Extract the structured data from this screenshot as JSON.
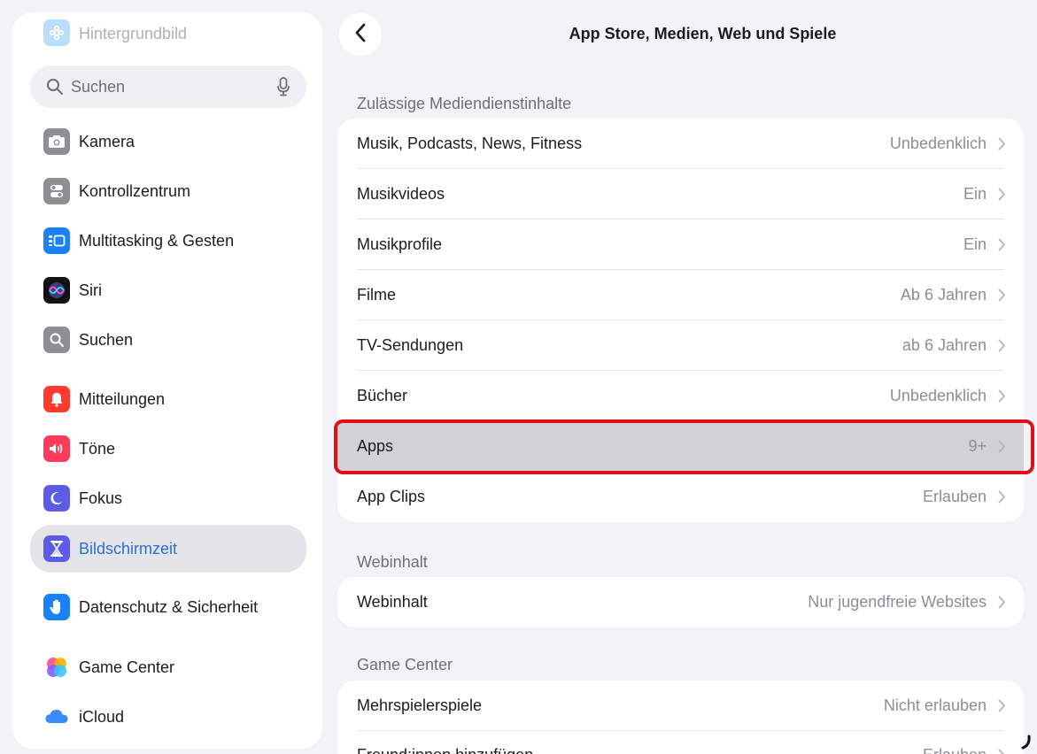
{
  "sidebar": {
    "top_item": "Hintergrundbild",
    "search_placeholder": "Suchen",
    "items": [
      {
        "label": "Kamera"
      },
      {
        "label": "Kontrollzentrum"
      },
      {
        "label": "Multitasking & Gesten"
      },
      {
        "label": "Siri"
      },
      {
        "label": "Suchen"
      },
      {
        "label": "Mitteilungen"
      },
      {
        "label": "Töne"
      },
      {
        "label": "Fokus"
      },
      {
        "label": "Bildschirmzeit",
        "selected": true
      },
      {
        "label": "Datenschutz & Sicherheit"
      },
      {
        "label": "Game Center"
      },
      {
        "label": "iCloud"
      }
    ]
  },
  "header": {
    "title": "App Store, Medien, Web und Spiele"
  },
  "sections": {
    "media": {
      "header": "Zulässige Mediendienstinhalte",
      "rows": [
        {
          "label": "Musik, Podcasts, News, Fitness",
          "value": "Unbedenklich"
        },
        {
          "label": "Musikvideos",
          "value": "Ein"
        },
        {
          "label": "Musikprofile",
          "value": "Ein"
        },
        {
          "label": "Filme",
          "value": "Ab 6 Jahren"
        },
        {
          "label": "TV-Sendungen",
          "value": "ab 6 Jahren"
        },
        {
          "label": "Bücher",
          "value": "Unbedenklich"
        },
        {
          "label": "Apps",
          "value": "9+"
        },
        {
          "label": "App Clips",
          "value": "Erlauben"
        }
      ]
    },
    "web": {
      "header": "Webinhalt",
      "rows": [
        {
          "label": "Webinhalt",
          "value": "Nur jugendfreie Websites"
        }
      ]
    },
    "game_center": {
      "header": "Game Center",
      "rows": [
        {
          "label": "Mehrspielerspiele",
          "value": "Nicht erlauben"
        },
        {
          "label": "Freund:innen hinzufügen",
          "value": "Erlauben"
        }
      ]
    }
  },
  "colors": {
    "accent": "#2b6fd6",
    "highlight_outline": "#e0101a"
  }
}
